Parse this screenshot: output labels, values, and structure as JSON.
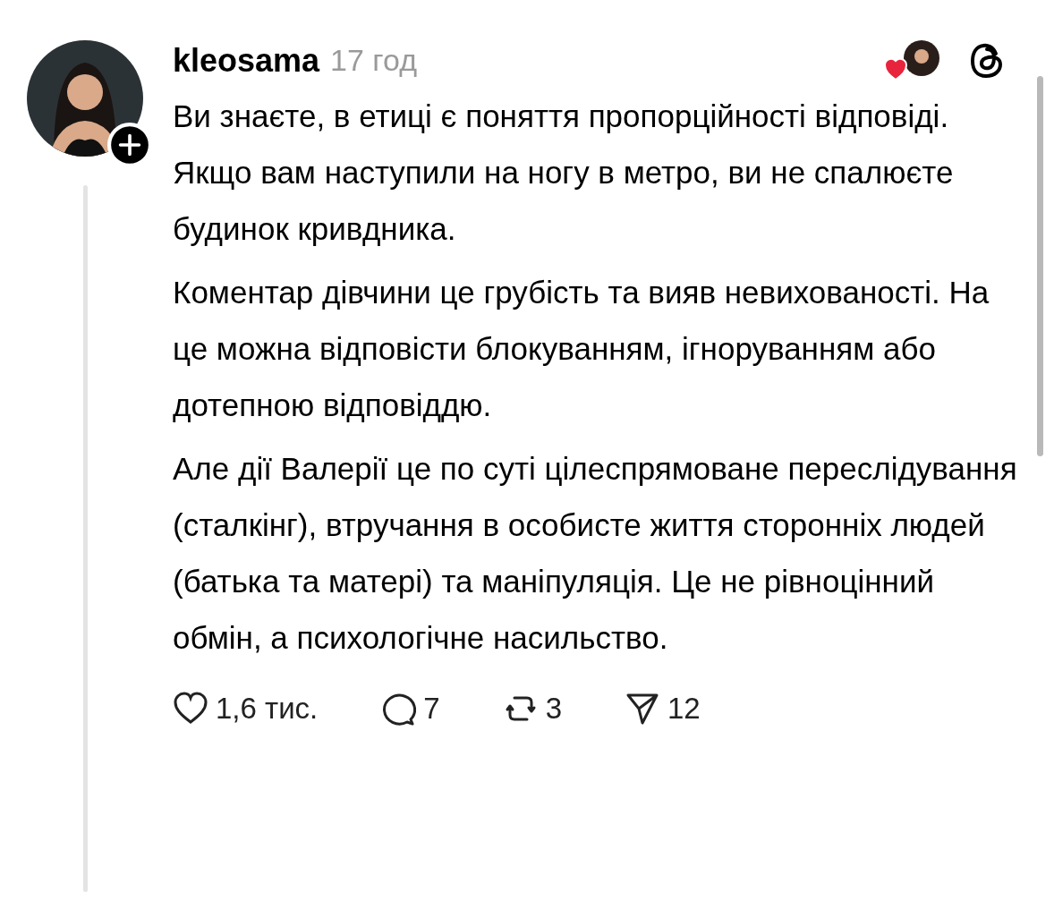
{
  "post": {
    "username": "kleosama",
    "time": "17 год",
    "paragraphs": [
      "Ви знаєте, в етиці є поняття пропорційності відповіді. Якщо вам наступили на ногу в метро, ви не спалюєте будинок кривдника.",
      "Коментар дівчини це грубість та  вияв невихованості. На це можна відповісти блокуванням, ігноруванням або дотепною відповіддю.",
      "Але дії Валерії це по суті цілеспрямоване переслідування (сталкінг), втручання в особисте життя сторонніх людей (батька та матері) та маніпуляція. Це не рівноцінний обмін, а психологічне насильство."
    ],
    "actions": [
      {
        "kind": "like",
        "count": "1,6 тис."
      },
      {
        "kind": "comment",
        "count": "7"
      },
      {
        "kind": "repost",
        "count": "3"
      },
      {
        "kind": "share",
        "count": "12"
      }
    ]
  }
}
